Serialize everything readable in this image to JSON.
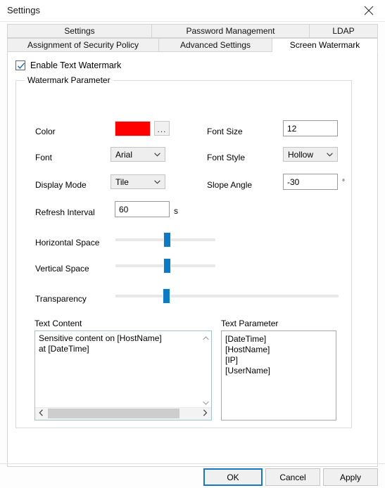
{
  "window": {
    "title": "Settings",
    "close_icon": "close-icon"
  },
  "tabs": {
    "row1": [
      {
        "label": "Settings",
        "active": false
      },
      {
        "label": "Password Management",
        "active": false
      },
      {
        "label": "LDAP",
        "active": false
      }
    ],
    "row2": [
      {
        "label": "Assignment of Security Policy",
        "active": false
      },
      {
        "label": "Advanced Settings",
        "active": false
      },
      {
        "label": "Screen Watermark",
        "active": true
      }
    ]
  },
  "enable_watermark": {
    "label": "Enable Text Watermark",
    "checked": true,
    "check_icon": "check-icon"
  },
  "group": {
    "legend": "Watermark Parameter"
  },
  "fields": {
    "color": {
      "label": "Color",
      "value_hex": "#FF0000",
      "browse_label": "...",
      "browse_icon": "ellipsis-icon"
    },
    "font_size": {
      "label": "Font Size",
      "value": "12"
    },
    "font": {
      "label": "Font",
      "value": "Arial",
      "chevron_icon": "chevron-down-icon"
    },
    "font_style": {
      "label": "Font Style",
      "value": "Hollow",
      "chevron_icon": "chevron-down-icon"
    },
    "display_mode": {
      "label": "Display Mode",
      "value": "Tile",
      "chevron_icon": "chevron-down-icon"
    },
    "slope_angle": {
      "label": "Slope Angle",
      "value": "-30",
      "unit": "°"
    },
    "refresh_interval": {
      "label": "Refresh Interval",
      "value": "60",
      "unit": "s"
    }
  },
  "sliders": {
    "horizontal_space": {
      "label": "Horizontal Space",
      "percent": 48
    },
    "vertical_space": {
      "label": "Vertical Space",
      "percent": 48
    },
    "transparency": {
      "label": "Transparency",
      "percent": 21
    }
  },
  "text_content": {
    "label": "Text Content",
    "value": "Sensitive content on [HostName]\nat [DateTime]",
    "scroll_up_icon": "chevron-up-icon",
    "scroll_down_icon": "chevron-down-icon",
    "scroll_left_icon": "chevron-left-icon",
    "scroll_right_icon": "chevron-right-icon"
  },
  "text_parameter": {
    "label": "Text Parameter",
    "items": [
      "[DateTime]",
      "[HostName]",
      "[IP]",
      "[UserName]"
    ]
  },
  "footer": {
    "ok": "OK",
    "cancel": "Cancel",
    "apply": "Apply"
  },
  "colors": {
    "accent": "#0e7ac4",
    "focus_border": "#1779c4",
    "swatch": "#FF0000"
  }
}
